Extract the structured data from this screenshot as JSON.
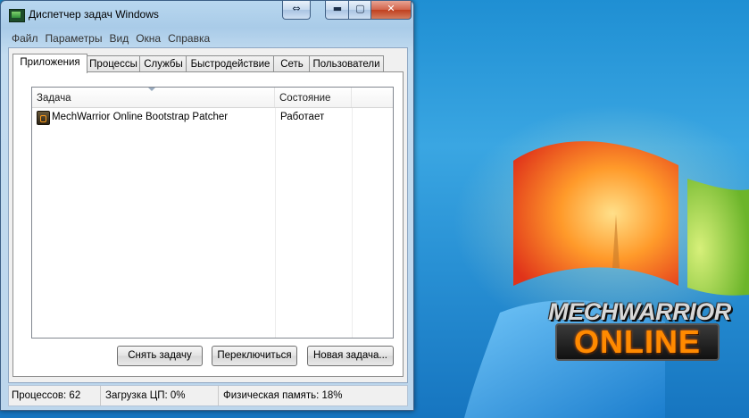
{
  "window": {
    "title": "Диспетчер задач Windows"
  },
  "menu": [
    "Файл",
    "Параметры",
    "Вид",
    "Окна",
    "Справка"
  ],
  "tabs": [
    {
      "label": "Приложения",
      "active": true
    },
    {
      "label": "Процессы",
      "active": false
    },
    {
      "label": "Службы",
      "active": false
    },
    {
      "label": "Быстродействие",
      "active": false
    },
    {
      "label": "Сеть",
      "active": false
    },
    {
      "label": "Пользователи",
      "active": false
    }
  ],
  "table": {
    "columns": [
      "Задача",
      "Состояние"
    ],
    "rows": [
      {
        "task": "MechWarrior Online Bootstrap Patcher",
        "status": "Работает"
      }
    ]
  },
  "buttons": {
    "end_task": "Снять задачу",
    "switch_to": "Переключиться",
    "new_task": "Новая задача..."
  },
  "status": {
    "processes": "Процессов: 62",
    "cpu": "Загрузка ЦП: 0%",
    "memory": "Физическая память: 18%"
  },
  "desktop": {
    "logo_line1": "MECHWARRIOR",
    "logo_line2": "ONLINE"
  },
  "colors": {
    "desktop_blue": "#1f8fd3",
    "logo_orange": "#ff8a00"
  }
}
